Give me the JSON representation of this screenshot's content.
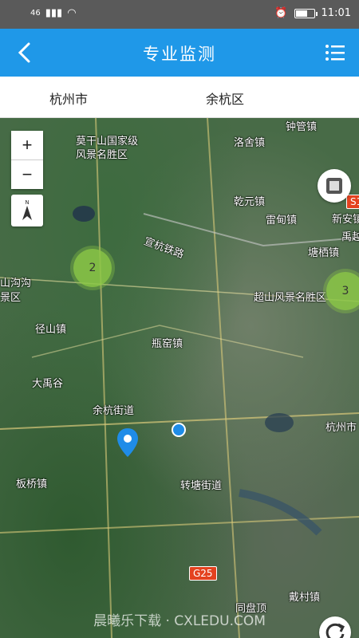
{
  "status_bar": {
    "signal": "46",
    "time": "11:01"
  },
  "app_bar": {
    "title": "专业监测"
  },
  "filters": {
    "city": "杭州市",
    "district": "余杭区"
  },
  "map": {
    "zoom_in": "+",
    "zoom_out": "−",
    "compass_n": "N",
    "clusters": [
      {
        "count": "2"
      },
      {
        "count": "3"
      }
    ],
    "places": [
      {
        "name": "莫干山国家级"
      },
      {
        "name": "风景名胜区"
      },
      {
        "name": "洛舍镇"
      },
      {
        "name": "钟管镇"
      },
      {
        "name": "乾元镇"
      },
      {
        "name": "雷甸镇"
      },
      {
        "name": "新安镇"
      },
      {
        "name": "禹越"
      },
      {
        "name": "宣杭铁路"
      },
      {
        "name": "塘栖镇"
      },
      {
        "name": "山沟沟"
      },
      {
        "name": "景区"
      },
      {
        "name": "超山风景名胜区"
      },
      {
        "name": "径山镇"
      },
      {
        "name": "瓶窑镇"
      },
      {
        "name": "大禹谷"
      },
      {
        "name": "余杭街道"
      },
      {
        "name": "杭州市"
      },
      {
        "name": "板桥镇"
      },
      {
        "name": "转塘街道"
      },
      {
        "name": "同盘顶"
      },
      {
        "name": "戴村镇"
      }
    ],
    "road_badges": [
      {
        "text": "S1"
      },
      {
        "text": "G25"
      }
    ],
    "watermark": "晨曦乐下载 · CXLEDU.COM"
  }
}
